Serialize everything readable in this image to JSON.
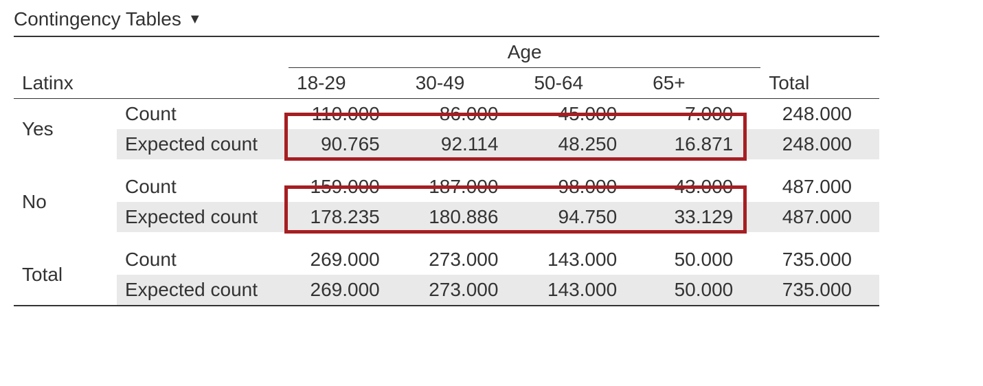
{
  "section": {
    "title": "Contingency Tables",
    "caret_icon": "▼"
  },
  "table": {
    "row_var_label": "Latinx",
    "col_var_label": "Age",
    "total_label": "Total",
    "age_cols": [
      "18-29",
      "30-49",
      "50-64",
      "65+"
    ],
    "stat_labels": {
      "count": "Count",
      "expected": "Expected count"
    },
    "groups": [
      {
        "label": "Yes",
        "count": [
          "110.000",
          "86.000",
          "45.000",
          "7.000",
          "248.000"
        ],
        "expected": [
          "90.765",
          "92.114",
          "48.250",
          "16.871",
          "248.000"
        ],
        "highlight_expected": true
      },
      {
        "label": "No",
        "count": [
          "159.000",
          "187.000",
          "98.000",
          "43.000",
          "487.000"
        ],
        "expected": [
          "178.235",
          "180.886",
          "94.750",
          "33.129",
          "487.000"
        ],
        "highlight_expected": true
      },
      {
        "label": "Total",
        "count": [
          "269.000",
          "273.000",
          "143.000",
          "50.000",
          "735.000"
        ],
        "expected": [
          "269.000",
          "273.000",
          "143.000",
          "50.000",
          "735.000"
        ],
        "highlight_expected": false
      }
    ]
  }
}
